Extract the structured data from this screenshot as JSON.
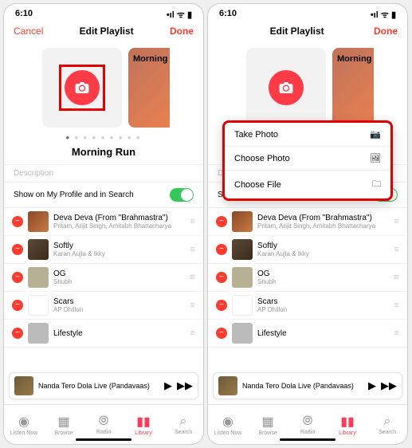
{
  "status": {
    "time": "6:10",
    "icons": "•ıl ᯤ ▮"
  },
  "nav": {
    "cancel": "Cancel",
    "title": "Edit Playlist",
    "done": "Done"
  },
  "card2_text": "Morning",
  "playlist_title": "Morning Run",
  "description_placeholder": "Description",
  "profile_toggle": "Show on My Profile and in Search",
  "songs": [
    {
      "title": "Deva Deva (From \"Brahmastra\")",
      "artist": "Pritam, Arijit Singh, Amitabh Bhattacharya"
    },
    {
      "title": "Softly",
      "artist": "Karan Aujla & Ikky"
    },
    {
      "title": "OG",
      "artist": "Shubh"
    },
    {
      "title": "Scars",
      "artist": "AP Dhillon"
    },
    {
      "title": "Lifestyle",
      "artist": ""
    }
  ],
  "now_playing": {
    "title": "Nanda Tero Dola Live (Pandavaas)"
  },
  "tabs": [
    {
      "label": "Listen Now"
    },
    {
      "label": "Browse"
    },
    {
      "label": "Radio"
    },
    {
      "label": "Library"
    },
    {
      "label": "Search"
    }
  ],
  "menu": [
    {
      "label": "Take Photo",
      "icon": "camera"
    },
    {
      "label": "Choose Photo",
      "icon": "photo"
    },
    {
      "label": "Choose File",
      "icon": "file"
    }
  ]
}
